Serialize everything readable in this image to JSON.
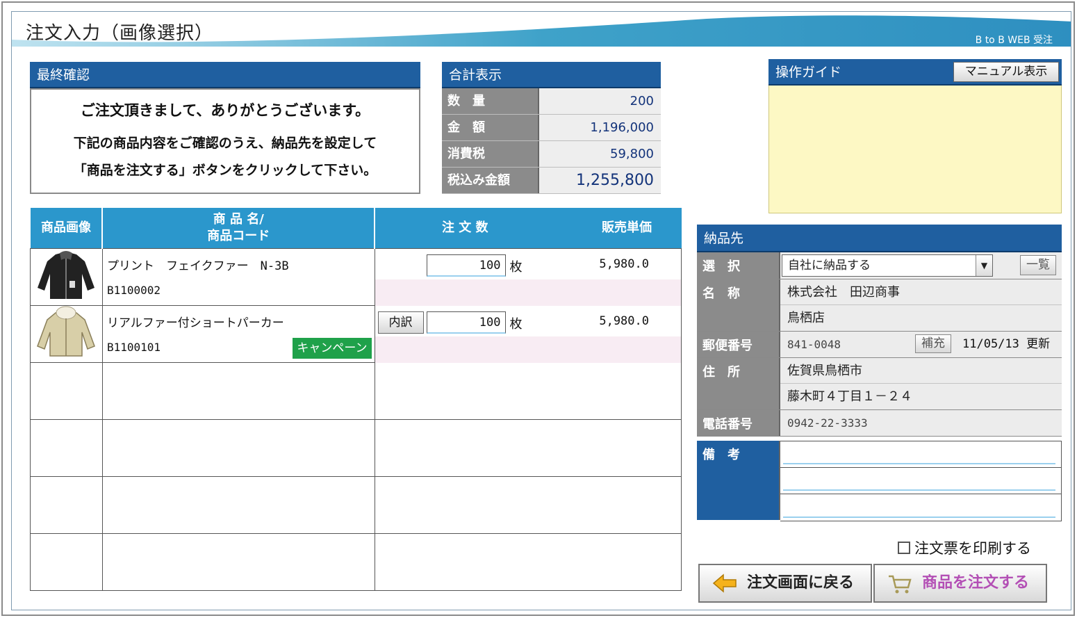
{
  "header": {
    "title": "注文入力（画像選択）",
    "brand": "B to B WEB 受注"
  },
  "confirm": {
    "title": "最終確認",
    "line1": "ご注文頂きまして、ありがとうございます。",
    "line2": "下記の商品内容をご確認のうえ、納品先を設定して",
    "line3": "「商品を注文する」ボタンをクリックして下さい。"
  },
  "totals": {
    "title": "合計表示",
    "rows": [
      {
        "label": "数　量",
        "value": "200"
      },
      {
        "label": "金　額",
        "value": "1,196,000"
      },
      {
        "label": "消費税",
        "value": "59,800"
      },
      {
        "label": "税込み金額",
        "value": "1,255,800"
      }
    ]
  },
  "guide": {
    "title": "操作ガイド",
    "manual_label": "マニュアル表示"
  },
  "product_table": {
    "headers": {
      "image": "商品画像",
      "name_line1": "商 品 名/",
      "name_line2": "商品コード",
      "qty": "注 文 数",
      "price": "販売単価"
    },
    "rows": [
      {
        "name": "プリント　フェイクファー　N-3B",
        "code": "B1100002",
        "qty": "100",
        "unit": "枚",
        "price": "5,980.0",
        "campaign": ""
      },
      {
        "name": "リアルファー付ショートパーカー",
        "code": "B1100101",
        "qty": "100",
        "unit": "枚",
        "price": "5,980.0",
        "campaign": "キャンペーン",
        "detail_label": "内訳"
      }
    ]
  },
  "delivery": {
    "title": "納品先",
    "select_label": "選　択",
    "select_value": "自社に納品する",
    "list_label": "一覧",
    "name_label": "名　称",
    "name_line1": "株式会社　田辺商事",
    "name_line2": "鳥栖店",
    "zip_label": "郵便番号",
    "zip_value": "841-0048",
    "hojyu_label": "補充",
    "updated": "11/05/13 更新",
    "address_label": "住　所",
    "address_line1": "佐賀県鳥栖市",
    "address_line2": "藤木町４丁目１－２４",
    "tel_label": "電話番号",
    "tel_value": "0942-22-3333",
    "remarks_label": "備　考"
  },
  "actions": {
    "print_label": "注文票を印刷する",
    "back_label": "注文画面に戻る",
    "order_label": "商品を注文する"
  },
  "colors": {
    "accent_blue": "#1f5fa0",
    "table_header": "#2b97cc",
    "campaign_green": "#1fa14a",
    "guide_bg": "#fdf8c4"
  }
}
